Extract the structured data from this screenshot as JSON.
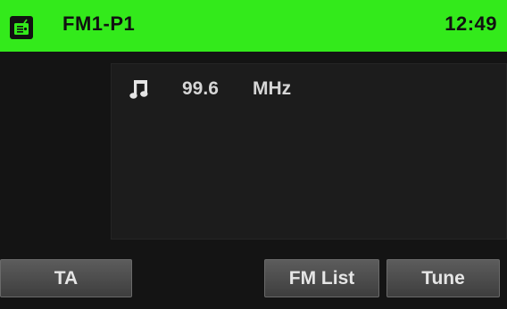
{
  "header": {
    "band_preset": "FM1-P1",
    "clock": "12:49",
    "icon": "radio-icon",
    "color": "#33ea1b"
  },
  "panel": {
    "icon": "music-note-icon",
    "frequency": "99.6",
    "unit": "MHz"
  },
  "buttons": {
    "ta": "TA",
    "fm_list": "FM List",
    "tune": "Tune"
  }
}
